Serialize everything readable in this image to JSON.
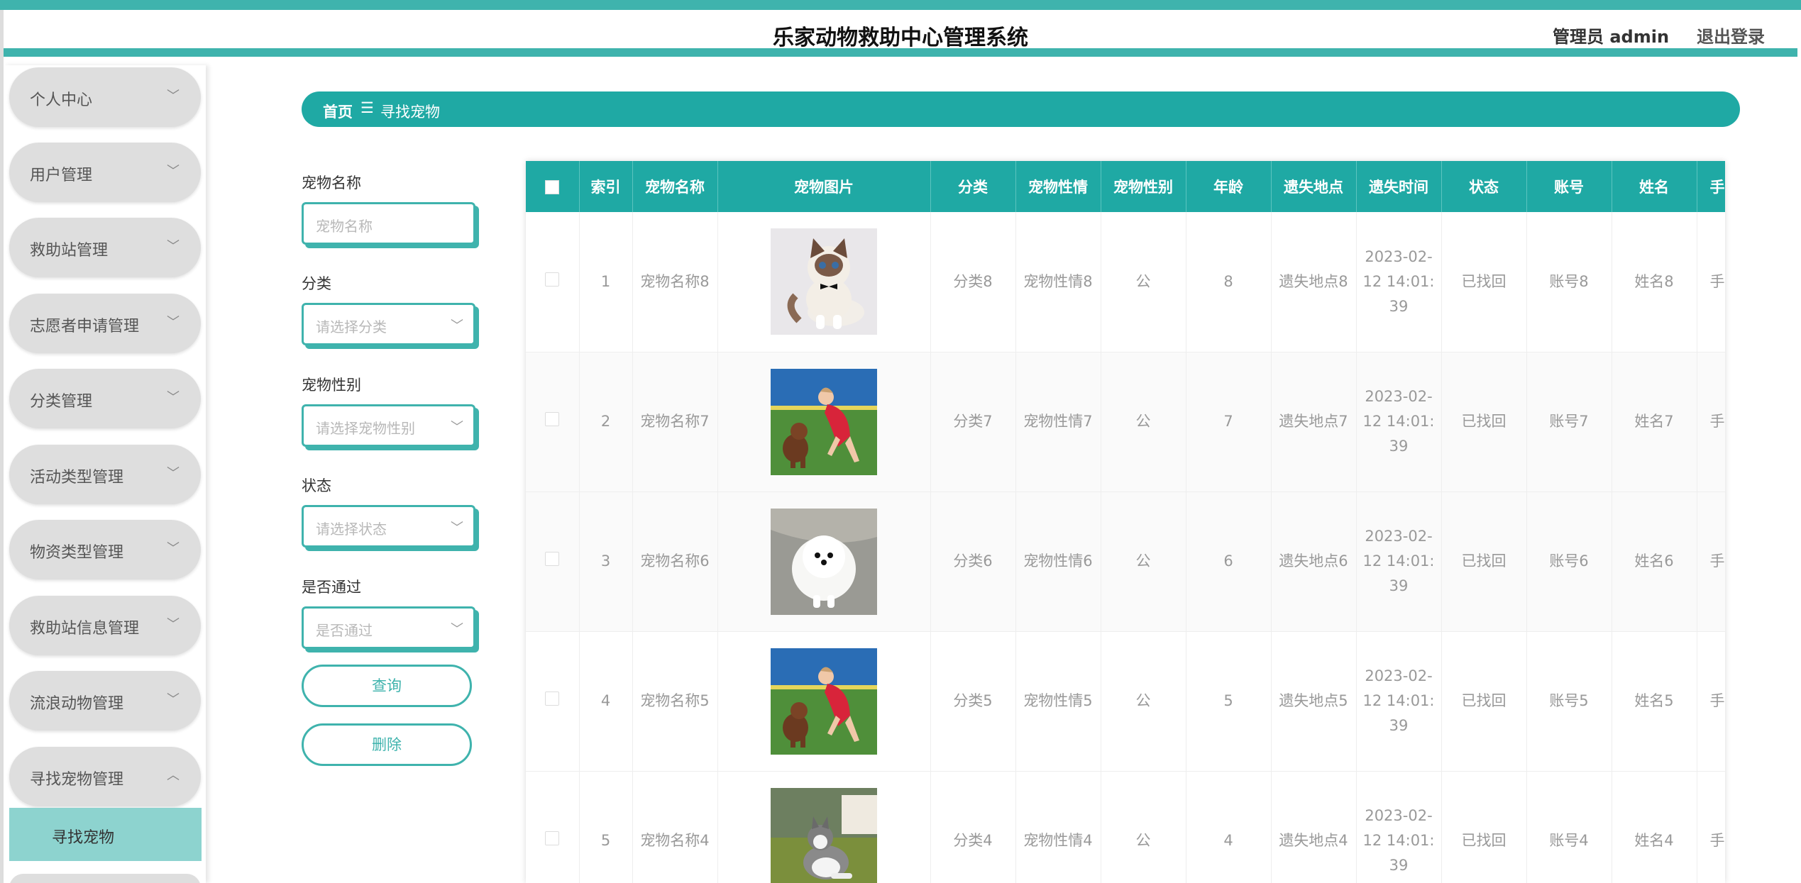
{
  "header": {
    "title": "乐家动物救助中心管理系统",
    "admin_label": "管理员 admin",
    "logout_label": "退出登录"
  },
  "sidebar": {
    "items": [
      {
        "label": "个人中心",
        "chevron": "chevron-down-icon"
      },
      {
        "label": "用户管理",
        "chevron": "chevron-down-icon"
      },
      {
        "label": "救助站管理",
        "chevron": "chevron-down-icon"
      },
      {
        "label": "志愿者申请管理",
        "chevron": "chevron-down-icon"
      },
      {
        "label": "分类管理",
        "chevron": "chevron-down-icon"
      },
      {
        "label": "活动类型管理",
        "chevron": "chevron-down-icon"
      },
      {
        "label": "物资类型管理",
        "chevron": "chevron-down-icon"
      },
      {
        "label": "救助站信息管理",
        "chevron": "chevron-down-icon"
      },
      {
        "label": "流浪动物管理",
        "chevron": "chevron-down-icon"
      },
      {
        "label": "寻找宠物管理",
        "chevron": "chevron-up-icon"
      }
    ],
    "active_sub_item": "寻找宠物"
  },
  "breadcrumb": {
    "home": "首页",
    "current": "寻找宠物"
  },
  "filters": {
    "pet_name_label": "宠物名称",
    "pet_name_placeholder": "宠物名称",
    "category_label": "分类",
    "category_placeholder": "请选择分类",
    "gender_label": "宠物性别",
    "gender_placeholder": "请选择宠物性别",
    "status_label": "状态",
    "status_placeholder": "请选择状态",
    "approved_label": "是否通过",
    "approved_placeholder": "是否通过",
    "query_button": "查询",
    "delete_button": "删除"
  },
  "table": {
    "columns": [
      "索引",
      "宠物名称",
      "宠物图片",
      "分类",
      "宠物性情",
      "宠物性别",
      "年龄",
      "遗失地点",
      "遗失时间",
      "状态",
      "账号",
      "姓名",
      "手"
    ],
    "rows": [
      {
        "index": "1",
        "name": "宠物名称8",
        "image": "ragdoll-cat-bowtie",
        "category": "分类8",
        "temperament": "宠物性情8",
        "gender": "公",
        "age": "8",
        "lost_place": "遗失地点8",
        "lost_time": "2023-02-12 14:01:39",
        "status": "已找回",
        "account": "账号8",
        "real_name": "姓名8",
        "phone": "手"
      },
      {
        "index": "2",
        "name": "宠物名称7",
        "image": "girl-with-poodle",
        "category": "分类7",
        "temperament": "宠物性情7",
        "gender": "公",
        "age": "7",
        "lost_place": "遗失地点7",
        "lost_time": "2023-02-12 14:01:39",
        "status": "已找回",
        "account": "账号7",
        "real_name": "姓名7",
        "phone": "手"
      },
      {
        "index": "3",
        "name": "宠物名称6",
        "image": "white-pomeranian",
        "category": "分类6",
        "temperament": "宠物性情6",
        "gender": "公",
        "age": "6",
        "lost_place": "遗失地点6",
        "lost_time": "2023-02-12 14:01:39",
        "status": "已找回",
        "account": "账号6",
        "real_name": "姓名6",
        "phone": "手"
      },
      {
        "index": "4",
        "name": "宠物名称5",
        "image": "girl-with-poodle",
        "category": "分类5",
        "temperament": "宠物性情5",
        "gender": "公",
        "age": "5",
        "lost_place": "遗失地点5",
        "lost_time": "2023-02-12 14:01:39",
        "status": "已找回",
        "account": "账号5",
        "real_name": "姓名5",
        "phone": "手"
      },
      {
        "index": "5",
        "name": "宠物名称4",
        "image": "husky-on-grass",
        "category": "分类4",
        "temperament": "宠物性情4",
        "gender": "公",
        "age": "4",
        "lost_place": "遗失地点4",
        "lost_time": "2023-02-12 14:01:39",
        "status": "已找回",
        "account": "账号4",
        "real_name": "姓名4",
        "phone": "手"
      }
    ]
  },
  "colors": {
    "primary": "#1fa9a4",
    "accent": "#3fb3ad",
    "sidebar_item_bg": "#dedede",
    "sidebar_active_bg": "#8dd3cf"
  }
}
